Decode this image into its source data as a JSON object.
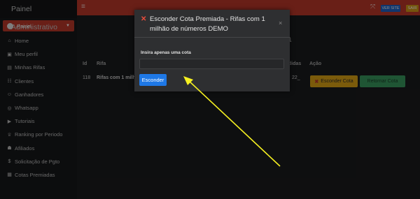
{
  "sidebar": {
    "brand": "Painel Administrativo",
    "panel_button": "Painel",
    "items": [
      {
        "label": "Home",
        "icon": "home-icon",
        "glyph": "⌂"
      },
      {
        "label": "Meu perfil",
        "icon": "profile-icon",
        "glyph": "▣"
      },
      {
        "label": "Minhas Rifas",
        "icon": "ticket-icon",
        "glyph": "▤"
      },
      {
        "label": "Clientes",
        "icon": "clients-icon",
        "glyph": "☷"
      },
      {
        "label": "Ganhadores",
        "icon": "trophy-icon",
        "glyph": "☺"
      },
      {
        "label": "Whatsapp",
        "icon": "whatsapp-icon",
        "glyph": "◎"
      },
      {
        "label": "Tutoriais",
        "icon": "video-icon",
        "glyph": "▶"
      },
      {
        "label": "Ranking por Periodo",
        "icon": "ranking-icon",
        "glyph": "♕"
      },
      {
        "label": "Afiliados",
        "icon": "affiliates-icon",
        "glyph": "☗"
      },
      {
        "label": "Solicitação de Pgto",
        "icon": "dollar-icon",
        "glyph": "$"
      },
      {
        "label": "Cotas Premiadas",
        "icon": "gift-icon",
        "glyph": "▦"
      }
    ]
  },
  "topbar": {
    "site_button": "VER SITE",
    "exit_button": "SAIR",
    "accent": "#c0392b"
  },
  "page": {
    "title_fragment": "ada"
  },
  "table": {
    "headers": {
      "id": "Id",
      "rifa": "Rifa",
      "vendidas": "didas",
      "acao": "Ação"
    },
    "row": {
      "id": "118",
      "rifa": "Rifas com 1 milhão",
      "vendidas": "22_"
    },
    "hide_button": "Esconder Cota",
    "back_button": "Retornar Cota"
  },
  "modal": {
    "title": "Esconder Cota Premiada - Rifas com 1 milhão de números DEMO",
    "label": "Insira apenas uma cota",
    "input_value": "",
    "submit_label": "Esconder",
    "close_glyph": "×"
  }
}
